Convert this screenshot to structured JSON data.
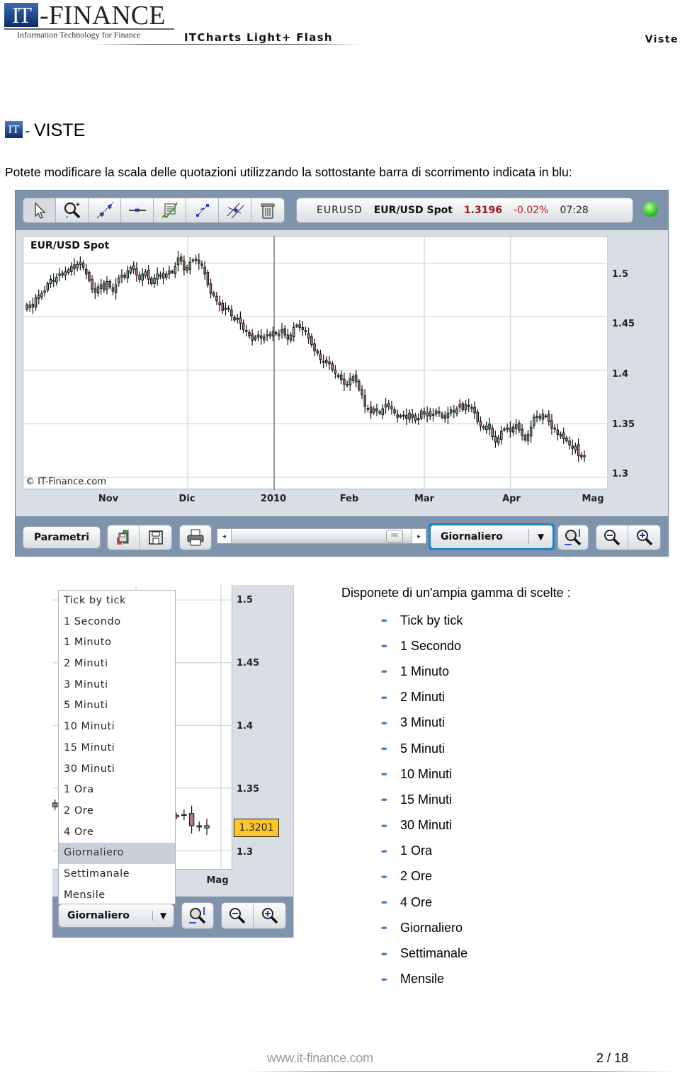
{
  "header": {
    "logo_mark": "IT",
    "logo_text": "-FINANCE",
    "logo_tagline": "Information Technology for Finance",
    "product_name": "ITCharts Light+ Flash",
    "section_label": "Viste"
  },
  "section": {
    "icon_text": "IT",
    "dash": "-",
    "title": "VISTE",
    "intro": "Potete modificare la scala delle quotazioni utilizzando la sottostante barra di scorrimento indicata in blu:"
  },
  "toolbar": {
    "tools": [
      {
        "name": "select-pointer",
        "icon": "cursor-arrow-icon"
      },
      {
        "name": "zoom-in-area",
        "icon": "zoom-area-icon"
      },
      {
        "name": "trend-line",
        "icon": "trendline-icon"
      },
      {
        "name": "horizontal-line",
        "icon": "horizontal-line-icon"
      },
      {
        "name": "indicators",
        "icon": "indicator-chart-icon"
      },
      {
        "name": "fibonacci-fan",
        "icon": "fan-lines-icon"
      },
      {
        "name": "parallel-channel",
        "icon": "channel-icon"
      },
      {
        "name": "delete-drawings",
        "icon": "trash-icon"
      }
    ],
    "ticker": {
      "symbol": "EURUSD",
      "name": "EUR/USD Spot",
      "price": "1.3196",
      "change": "-0.02%",
      "time": "07:28",
      "price_color": "#9b1515",
      "status": "connected"
    }
  },
  "chart_data": {
    "type": "candlestick",
    "title": "EUR/USD Spot",
    "watermark": "© IT-Finance.com",
    "xlabel": "",
    "ylabel": "",
    "x_ticks": [
      "Nov",
      "Dic",
      "2010",
      "Feb",
      "Mar",
      "Apr",
      "Mag"
    ],
    "y_ticks": [
      "1.5",
      "1.45",
      "1.4",
      "1.35",
      "1.3"
    ],
    "ylim": [
      1.288,
      1.525
    ],
    "grid": true,
    "up_color": "#7fbf8a",
    "down_color": "#b07a7f",
    "note": "approximate daily closes read from candle positions, Oct 2009 to May 2010",
    "closes": [
      1.457,
      1.461,
      1.459,
      1.468,
      1.47,
      1.472,
      1.474,
      1.481,
      1.485,
      1.484,
      1.487,
      1.49,
      1.489,
      1.492,
      1.494,
      1.497,
      1.495,
      1.499,
      1.501,
      1.496,
      1.49,
      1.484,
      1.476,
      1.473,
      1.478,
      1.48,
      1.475,
      1.483,
      1.478,
      1.474,
      1.48,
      1.486,
      1.489,
      1.487,
      1.493,
      1.496,
      1.494,
      1.489,
      1.485,
      1.49,
      1.492,
      1.485,
      1.481,
      1.486,
      1.49,
      1.489,
      1.486,
      1.49,
      1.493,
      1.492,
      1.497,
      1.505,
      1.502,
      1.494,
      1.496,
      1.501,
      1.503,
      1.503,
      1.5,
      1.498,
      1.49,
      1.48,
      1.472,
      1.47,
      1.465,
      1.461,
      1.456,
      1.458,
      1.457,
      1.451,
      1.447,
      1.448,
      1.444,
      1.438,
      1.437,
      1.432,
      1.428,
      1.431,
      1.433,
      1.43,
      1.431,
      1.433,
      1.432,
      1.436,
      1.434,
      1.434,
      1.438,
      1.433,
      1.429,
      1.433,
      1.44,
      1.442,
      1.44,
      1.438,
      1.436,
      1.43,
      1.424,
      1.418,
      1.416,
      1.41,
      1.408,
      1.407,
      1.406,
      1.401,
      1.397,
      1.394,
      1.391,
      1.387,
      1.387,
      1.392,
      1.394,
      1.389,
      1.382,
      1.377,
      1.366,
      1.364,
      1.36,
      1.364,
      1.362,
      1.36,
      1.364,
      1.368,
      1.366,
      1.364,
      1.36,
      1.356,
      1.357,
      1.358,
      1.355,
      1.36,
      1.356,
      1.353,
      1.355,
      1.362,
      1.359,
      1.36,
      1.357,
      1.359,
      1.362,
      1.361,
      1.356,
      1.355,
      1.36,
      1.363,
      1.361,
      1.364,
      1.368,
      1.363,
      1.368,
      1.367,
      1.364,
      1.36,
      1.352,
      1.348,
      1.346,
      1.348,
      1.345,
      1.338,
      1.333,
      1.337,
      1.343,
      1.345,
      1.346,
      1.343,
      1.347,
      1.349,
      1.344,
      1.339,
      1.335,
      1.34,
      1.347,
      1.356,
      1.357,
      1.355,
      1.359,
      1.357,
      1.352,
      1.346,
      1.345,
      1.34,
      1.34,
      1.336,
      1.334,
      1.33,
      1.327,
      1.329,
      1.32,
      1.319,
      1.3201
    ]
  },
  "controls": {
    "params_label": "Parametri",
    "save_template_icon": "save-template-icon",
    "save_icon": "floppy-disk-icon",
    "print_icon": "printer-icon",
    "scroll_left": "◂",
    "scroll_right": "▸",
    "scroll_thumb_grip": "IIIII",
    "scroll_position": 0.82,
    "period_value": "Giornaliero",
    "caret": "▼",
    "autoscale_icon": "autoscale-zoom-icon",
    "zoom_out_icon": "zoom-out-icon",
    "zoom_in_icon": "zoom-in-icon"
  },
  "mini": {
    "y_ticks": [
      "1.5",
      "1.45",
      "1.4",
      "1.35",
      "1.3"
    ],
    "x_tick": "Mag",
    "last_price": "1.3201",
    "dropdown": {
      "options": [
        "Tick by tick",
        "1 Secondo",
        "1 Minuto",
        "2 Minuti",
        "3 Minuti",
        "5 Minuti",
        "10 Minuti",
        "15 Minuti",
        "30 Minuti",
        "1 Ora",
        "2 Ore",
        "4 Ore",
        "Giornaliero",
        "Settimanale",
        "Mensile"
      ],
      "selected": "Giornaliero"
    },
    "period_value": "Giornaliero",
    "caret": "▼"
  },
  "choices": {
    "title": "Disponete di un'ampia gamma di scelte :",
    "bullet": "➨",
    "items": [
      "Tick by tick",
      "1 Secondo",
      "1 Minuto",
      "2 Minuti",
      "3 Minuti",
      "5 Minuti",
      "10 Minuti",
      "15 Minuti",
      "30 Minuti",
      "1 Ora",
      "2 Ore",
      "4 Ore",
      "Giornaliero",
      "Settimanale",
      "Mensile"
    ]
  },
  "footer": {
    "url": "www.it-finance.com",
    "page": "2 / 18"
  }
}
